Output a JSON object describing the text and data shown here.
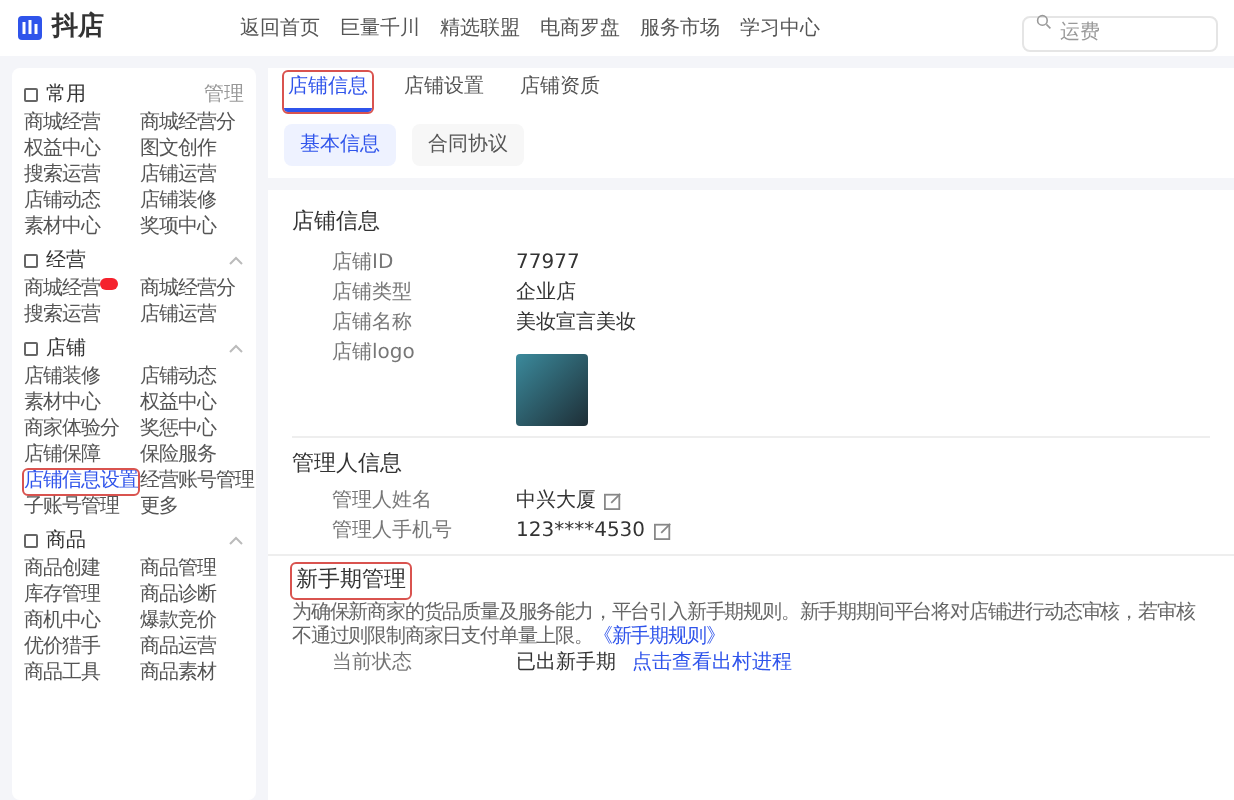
{
  "logo": {
    "text": "抖店"
  },
  "nav": [
    "返回首页",
    "巨量千川",
    "精选联盟",
    "电商罗盘",
    "服务市场",
    "学习中心"
  ],
  "search": {
    "placeholder": "运费"
  },
  "sidebar": [
    {
      "title": "常用",
      "action": "管理",
      "items": [
        {
          "label": "商城经营",
          "selected": false
        },
        {
          "label": "商城经营分",
          "selected": false
        },
        {
          "label": "权益中心",
          "selected": false
        },
        {
          "label": "图文创作",
          "selected": false
        },
        {
          "label": "搜索运营",
          "selected": false
        },
        {
          "label": "店铺运营",
          "selected": false
        },
        {
          "label": "店铺动态",
          "selected": false
        },
        {
          "label": "店铺装修",
          "selected": false
        },
        {
          "label": "素材中心",
          "selected": false
        },
        {
          "label": "奖项中心",
          "selected": false
        }
      ]
    },
    {
      "title": "经营",
      "expanded": true,
      "items": [
        {
          "label": "商城经营",
          "selected": false,
          "badge": true
        },
        {
          "label": "商城经营分",
          "selected": false
        },
        {
          "label": "搜索运营",
          "selected": false
        },
        {
          "label": "店铺运营",
          "selected": false
        }
      ]
    },
    {
      "title": "店铺",
      "expanded": true,
      "items": [
        {
          "label": "店铺装修",
          "selected": false
        },
        {
          "label": "店铺动态",
          "selected": false
        },
        {
          "label": "素材中心",
          "selected": false
        },
        {
          "label": "权益中心",
          "selected": false
        },
        {
          "label": "商家体验分",
          "selected": false
        },
        {
          "label": "奖惩中心",
          "selected": false
        },
        {
          "label": "店铺保障",
          "selected": false
        },
        {
          "label": "保险服务",
          "selected": false
        },
        {
          "label": "店铺信息设置",
          "selected": true
        },
        {
          "label": "经营账号管理",
          "selected": false
        },
        {
          "label": "子账号管理",
          "selected": false
        },
        {
          "label": "更多",
          "selected": false
        }
      ]
    },
    {
      "title": "商品",
      "expanded": true,
      "items": [
        {
          "label": "商品创建",
          "selected": false
        },
        {
          "label": "商品管理",
          "selected": false
        },
        {
          "label": "库存管理",
          "selected": false
        },
        {
          "label": "商品诊断",
          "selected": false
        },
        {
          "label": "商机中心",
          "selected": false
        },
        {
          "label": "爆款竞价",
          "selected": false
        },
        {
          "label": "优价猎手",
          "selected": false
        },
        {
          "label": "商品运营",
          "selected": false
        },
        {
          "label": "商品工具",
          "selected": false
        },
        {
          "label": "商品素材",
          "selected": false
        }
      ]
    }
  ],
  "tabs": [
    {
      "label": "店铺信息",
      "selected": true
    },
    {
      "label": "店铺设置",
      "selected": false
    },
    {
      "label": "店铺资质",
      "selected": false
    }
  ],
  "subtabs": [
    {
      "label": "基本信息",
      "selected": true
    },
    {
      "label": "合同协议",
      "selected": false
    }
  ],
  "store_info": {
    "title": "店铺信息",
    "rows": [
      {
        "label": "店铺ID",
        "value": "77977",
        "kind": "text"
      },
      {
        "label": "店铺类型",
        "value": "企业店",
        "kind": "text"
      },
      {
        "label": "店铺名称",
        "value": "美妆宣言美妆",
        "kind": "text"
      },
      {
        "label": "店铺logo",
        "kind": "image"
      }
    ]
  },
  "manager_info": {
    "title": "管理人信息",
    "rows": [
      {
        "label": "管理人姓名",
        "value": "中兴大厦",
        "editable": true
      },
      {
        "label": "管理人手机号",
        "value": "123****4530",
        "editable": true
      }
    ]
  },
  "novice": {
    "title": "新手期管理",
    "highlighted": true,
    "description": "为确保新商家的货品质量及服务能力，平台引入新手期规则。新手期期间平台将对店铺进行动态审核，若审核不通过则限制商家日支付单量上限。",
    "rule_link": "《新手期规则》",
    "status_label": "当前状态",
    "status_value": "已出新手期",
    "status_link": "点击查看出村进程"
  }
}
